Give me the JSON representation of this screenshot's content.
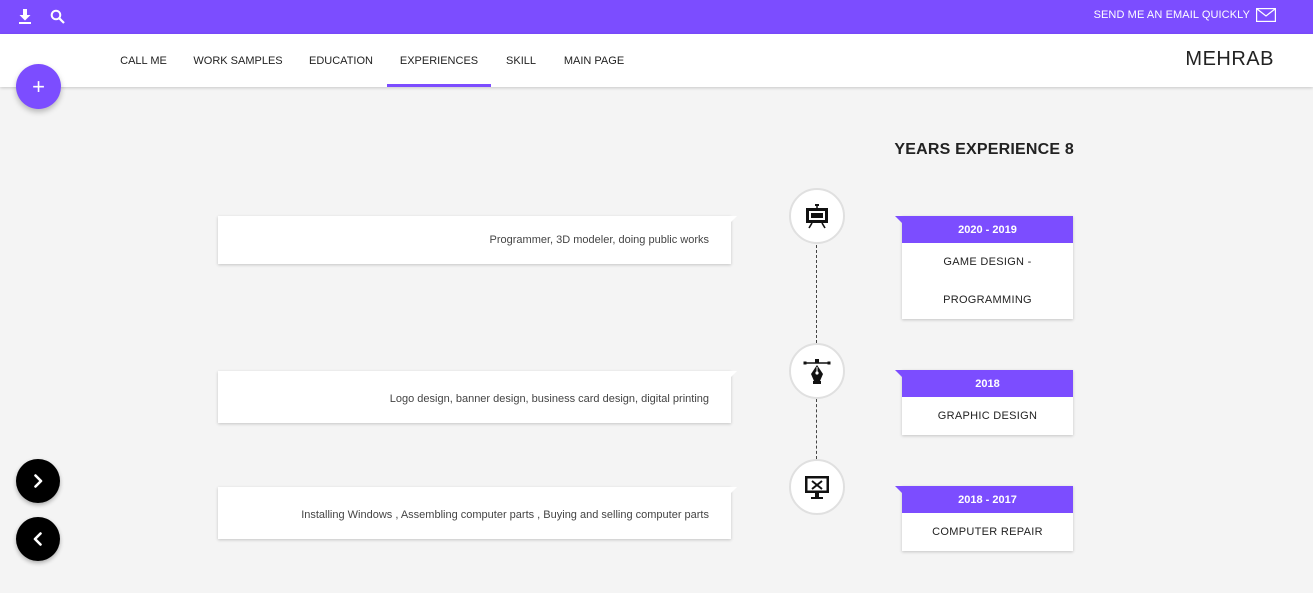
{
  "topbar": {
    "download_icon": "download-icon",
    "search_icon": "search-icon",
    "email_link": "SEND ME AN EMAIL QUICKLY",
    "email_icon": "envelope-icon",
    "color": "#7c4dff"
  },
  "nav": {
    "tabs": [
      {
        "label": "CALL ME"
      },
      {
        "label": "WORK SAMPLES"
      },
      {
        "label": "EDUCATION"
      },
      {
        "label": "EXPERIENCES",
        "active": true
      },
      {
        "label": "SKILL"
      },
      {
        "label": "MAIN PAGE"
      }
    ],
    "brand": "MEHRAB"
  },
  "fab": {
    "add_label": "+",
    "icon": "plus-icon"
  },
  "controls": {
    "next_icon": "chevron-right-icon",
    "prev_icon": "chevron-left-icon"
  },
  "section": {
    "title": "YEARS EXPERIENCE 8"
  },
  "experiences": [
    {
      "years": "2020 - 2019",
      "role_lines": [
        "GAME DESIGN -",
        "PROGRAMMING"
      ],
      "description": "Programmer, 3D modeler, doing public works",
      "icon": "presentation-board-icon"
    },
    {
      "years": "2018",
      "role_lines": [
        "GRAPHIC DESIGN"
      ],
      "description": "Logo design, banner design, business card design, digital printing",
      "icon": "pen-tool-icon"
    },
    {
      "years": "2018 - 2017",
      "role_lines": [
        "COMPUTER REPAIR"
      ],
      "description": "Installing Windows , Assembling computer parts , Buying and selling computer parts",
      "icon": "monitor-tools-icon"
    }
  ]
}
